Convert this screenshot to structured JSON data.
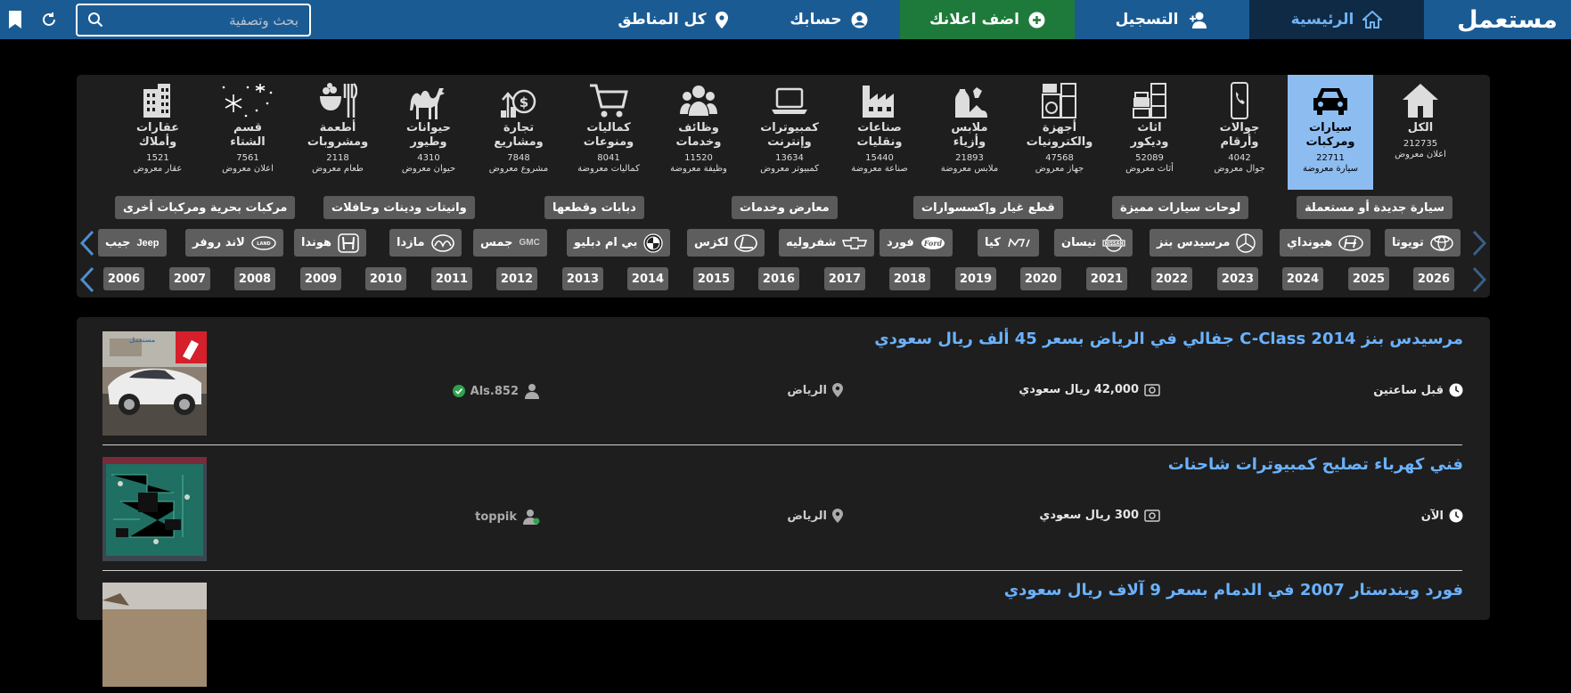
{
  "header": {
    "logo": "مستعمل",
    "nav": [
      {
        "label": "الرئيسية",
        "icon": "home-icon"
      },
      {
        "label": "التسجيل",
        "icon": "user-plus-icon"
      },
      {
        "label": "اضف اعلانك",
        "icon": "plus-circle-icon"
      },
      {
        "label": "حسابك",
        "icon": "user-circle-icon"
      },
      {
        "label": "كل المناطق",
        "icon": "map-pin-icon"
      }
    ],
    "search_placeholder": "بحث وتصفية",
    "colors": {
      "bar": "#1b5b94",
      "home_active": "#0f2a45",
      "add_ad": "#1e7a3a"
    }
  },
  "categories": [
    {
      "name": "الكل",
      "count": "212735",
      "unit": "اعلان معروض",
      "icon": "house-icon"
    },
    {
      "name": "سيارات\nومركبات",
      "count": "22711",
      "unit": "سيارة معروضة",
      "icon": "car-icon",
      "active": true
    },
    {
      "name": "جوالات\nوأرقام",
      "count": "4042",
      "unit": "جوال معروض",
      "icon": "phone-icon"
    },
    {
      "name": "اثاث\nوديكور",
      "count": "52089",
      "unit": "أثاث معروض",
      "icon": "furniture-icon"
    },
    {
      "name": "أجهزة\nوالكترونيات",
      "count": "47568",
      "unit": "جهاز معروض",
      "icon": "appliance-icon"
    },
    {
      "name": "ملابس\nوأزياء",
      "count": "21893",
      "unit": "ملابس معروضة",
      "icon": "clothes-icon"
    },
    {
      "name": "صناعات\nونقليات",
      "count": "15440",
      "unit": "صناعة معروضة",
      "icon": "factory-icon"
    },
    {
      "name": "كمبيوترات\nوإنترنت",
      "count": "13634",
      "unit": "كمبيوتر معروض",
      "icon": "laptop-icon"
    },
    {
      "name": "وظائف\nوخدمات",
      "count": "11520",
      "unit": "وظيفة معروضة",
      "icon": "people-icon"
    },
    {
      "name": "كماليات\nومنوعات",
      "count": "8041",
      "unit": "كماليات معروضة",
      "icon": "cart-icon"
    },
    {
      "name": "تجارة\nومشاريع",
      "count": "7848",
      "unit": "مشروع معروض",
      "icon": "money-growth-icon"
    },
    {
      "name": "حيوانات\nوطيور",
      "count": "4310",
      "unit": "حيوان معروض",
      "icon": "camel-icon"
    },
    {
      "name": "أطعمة\nومشروبات",
      "count": "2118",
      "unit": "طعام معروض",
      "icon": "food-icon"
    },
    {
      "name": "قسم\nالشتاء",
      "count": "7561",
      "unit": "اعلان معروض",
      "icon": "snowflake-icon"
    },
    {
      "name": "عقارات\nوأملاك",
      "count": "1521",
      "unit": "عقار معروض",
      "icon": "building-icon"
    }
  ],
  "subcategories": [
    "سيارة جديدة أو مستعملة",
    "لوحات سيارات مميزة",
    "قطع غيار وإكسسوارات",
    "معارض وخدمات",
    "دبابات وقطعها",
    "وانيتات ودينات وحافلات",
    "مركبات بحرية ومركبات أخرى"
  ],
  "brands": [
    {
      "name": "تويوتا",
      "logo": "toyota-logo"
    },
    {
      "name": "هيونداي",
      "logo": "hyundai-logo"
    },
    {
      "name": "مرسيدس بنز",
      "logo": "mercedes-logo"
    },
    {
      "name": "نيسان",
      "logo": "nissan-logo"
    },
    {
      "name": "كيا",
      "logo": "kia-logo"
    },
    {
      "name": "فورد",
      "logo": "ford-logo"
    },
    {
      "name": "شفروليه",
      "logo": "chevrolet-logo"
    },
    {
      "name": "لكزس",
      "logo": "lexus-logo"
    },
    {
      "name": "بي ام دبليو",
      "logo": "bmw-logo"
    },
    {
      "name": "جمس",
      "logo": "gmc-logo",
      "logo_text": "GMC"
    },
    {
      "name": "مازدا",
      "logo": "mazda-logo"
    },
    {
      "name": "هوندا",
      "logo": "honda-logo"
    },
    {
      "name": "لاند روفر",
      "logo": "landrover-logo"
    },
    {
      "name": "جيب",
      "logo": "jeep-logo",
      "logo_text": "Jeep"
    }
  ],
  "years": [
    "2026",
    "2025",
    "2024",
    "2023",
    "2022",
    "2021",
    "2020",
    "2019",
    "2018",
    "2017",
    "2016",
    "2015",
    "2014",
    "2013",
    "2012",
    "2011",
    "2010",
    "2009",
    "2008",
    "2007",
    "2006"
  ],
  "listings": [
    {
      "title": "مرسيدس بنز C-Class 2014 جفالي في الرياض بسعر 45 ألف ريال سعودي",
      "time": "قبل ساعتين",
      "price": "42,000 ريال سعودي",
      "city": "الرياض",
      "user": "Als.852",
      "verified": true,
      "thumb": "white-car-photo"
    },
    {
      "title": "فني كهرباء تصليح كمبيوترات شاحنات",
      "time": "الآن",
      "price": "300 ريال سعودي",
      "city": "الرياض",
      "user": "toppik",
      "verified": false,
      "thumb": "circuit-board-photo"
    },
    {
      "title": "فورد ويندستار 2007 في الدمام بسعر 9 آلاف ريال سعودي",
      "time": "",
      "price": "",
      "city": "",
      "user": "",
      "verified": false,
      "thumb": "building-photo"
    }
  ]
}
